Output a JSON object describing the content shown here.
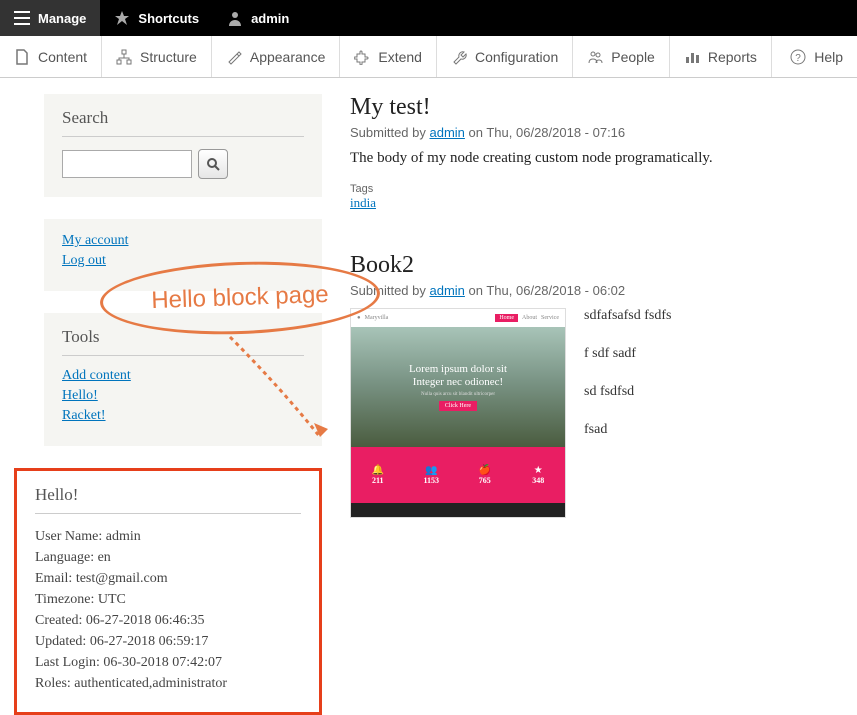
{
  "topbar": {
    "manage": "Manage",
    "shortcuts": "Shortcuts",
    "admin": "admin"
  },
  "admintabs": {
    "content": "Content",
    "structure": "Structure",
    "appearance": "Appearance",
    "extend": "Extend",
    "configuration": "Configuration",
    "people": "People",
    "reports": "Reports",
    "help": "Help"
  },
  "sidebar": {
    "search_title": "Search",
    "search_placeholder": "",
    "user_links": {
      "my_account": "My account",
      "logout": "Log out"
    },
    "tools_title": "Tools",
    "tools": {
      "add_content": "Add content",
      "hello": "Hello!",
      "racket": "Racket!"
    },
    "hello_block": {
      "title": "Hello!",
      "lines": {
        "l0": "User Name: admin",
        "l1": "Language: en",
        "l2": "Email: test@gmail.com",
        "l3": "Timezone: UTC",
        "l4": "Created: 06-27-2018 06:46:35",
        "l5": "Updated: 06-27-2018 06:59:17",
        "l6": "Last Login: 06-30-2018 07:42:07",
        "l7": "Roles: authenticated,administrator"
      }
    }
  },
  "annotation": {
    "text": "Hello block page"
  },
  "articles": {
    "a0": {
      "title": "My test!",
      "submitted_by": "Submitted by ",
      "author": "admin",
      "date": " on Thu, 06/28/2018 - 07:16",
      "body": "The body of my node creating custom node programatically.",
      "tags_label": "Tags",
      "tag": "india"
    },
    "a1": {
      "title": "Book2",
      "submitted_by": "Submitted by ",
      "author": "admin",
      "date": " on Thu, 06/28/2018 - 06:02",
      "thumb": {
        "brand": "Maryvilla",
        "lorem1": "Lorem ipsum dolor sit",
        "lorem2": "Integer nec odionec!",
        "stats": {
          "s0": "211",
          "s1": "1153",
          "s2": "765",
          "s3": "348"
        }
      },
      "lines": {
        "p0": "sdfafsafsd fsdfs",
        "p1": "f sdf sadf",
        "p2": "sd fsdfsd",
        "p3": "fsad"
      }
    }
  }
}
